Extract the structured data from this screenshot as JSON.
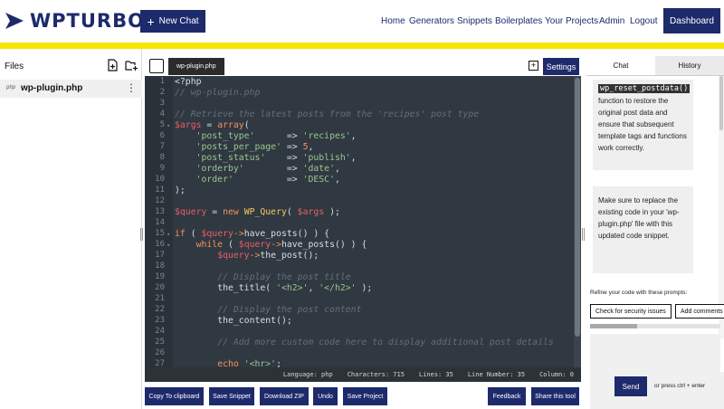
{
  "brand": {
    "name": "WPTURBO"
  },
  "header": {
    "new_chat": "New Chat",
    "nav": [
      "Home",
      "Generators",
      "Snippets",
      "Boilerplates",
      "Your Projects",
      "Admin",
      "Logout"
    ],
    "dashboard": "Dashboard"
  },
  "files": {
    "title": "Files",
    "items": [
      {
        "type": "php",
        "name": "wp-plugin.php"
      }
    ]
  },
  "editor": {
    "tab": "wp-plugin.php",
    "settings": "Settings",
    "line_numbers": [
      "1",
      "2",
      "3",
      "4",
      "5",
      "6",
      "7",
      "8",
      "9",
      "10",
      "11",
      "12",
      "13",
      "14",
      "15",
      "16",
      "17",
      "18",
      "19",
      "20",
      "21",
      "22",
      "23",
      "24",
      "25",
      "26",
      "27"
    ],
    "status": {
      "language": "Language: php",
      "characters": "Characters: 715",
      "lines": "Lines: 35",
      "line_number": "Line Number: 35",
      "column": "Column: 0"
    }
  },
  "code_colors": {
    "text": "#d8dee4",
    "comment": "#626f7a",
    "string": "#99c794",
    "variable": "#ec5f66",
    "keyword": "#f99157",
    "number": "#f99157",
    "function": "#fac863",
    "class": "#fac863"
  },
  "toolbar": {
    "copy": "Copy To clipboard",
    "save_snippet": "Save Snippet",
    "download": "Download ZIP",
    "undo": "Undo",
    "save_project": "Save Project",
    "feedback": "Feedback",
    "share": "Share this tool"
  },
  "chat": {
    "tab_chat": "Chat",
    "tab_history": "History",
    "msg1_code": "wp_reset_postdata()",
    "msg1_text": " function to restore the original post data and ensure that subsequent template tags and functions work correctly.",
    "msg2": "Make sure to replace the existing code in your 'wp-plugin.php' file with this updated code snippet.",
    "refine_label": "Refine your code with these prompts:",
    "prompts": [
      "Check for security issues",
      "Add comments"
    ],
    "send": "Send",
    "send_hint": "or press ctrl + enter"
  },
  "colors": {
    "brand": "#1d2a6b",
    "accent_yellow": "#f7e600",
    "editor_bg": "#303841"
  }
}
